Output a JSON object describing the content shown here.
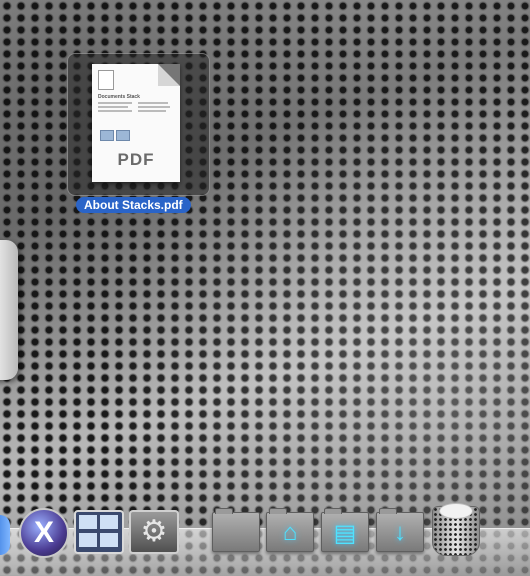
{
  "desktop": {
    "selected_file": {
      "name": "About Stacks.pdf",
      "preview_badge": "PDF",
      "preview_heading": "Documents Stack"
    }
  },
  "dock": {
    "items": [
      {
        "name": "finder",
        "icon": "finder-icon"
      },
      {
        "name": "mac-os-x",
        "icon": "x-logo-icon",
        "glyph": "X"
      },
      {
        "name": "spaces",
        "icon": "spaces-icon"
      },
      {
        "name": "system-preferences",
        "icon": "gear-icon",
        "glyph": "⚙"
      },
      {
        "name": "folder-stack-1",
        "icon": "folder-icon"
      },
      {
        "name": "applications-stack",
        "icon": "applications-folder-icon",
        "glyph": "⌂"
      },
      {
        "name": "documents-stack",
        "icon": "documents-folder-icon",
        "glyph": "▤"
      },
      {
        "name": "downloads-stack",
        "icon": "downloads-folder-icon",
        "glyph": "↓"
      },
      {
        "name": "trash",
        "icon": "trash-icon"
      }
    ]
  }
}
